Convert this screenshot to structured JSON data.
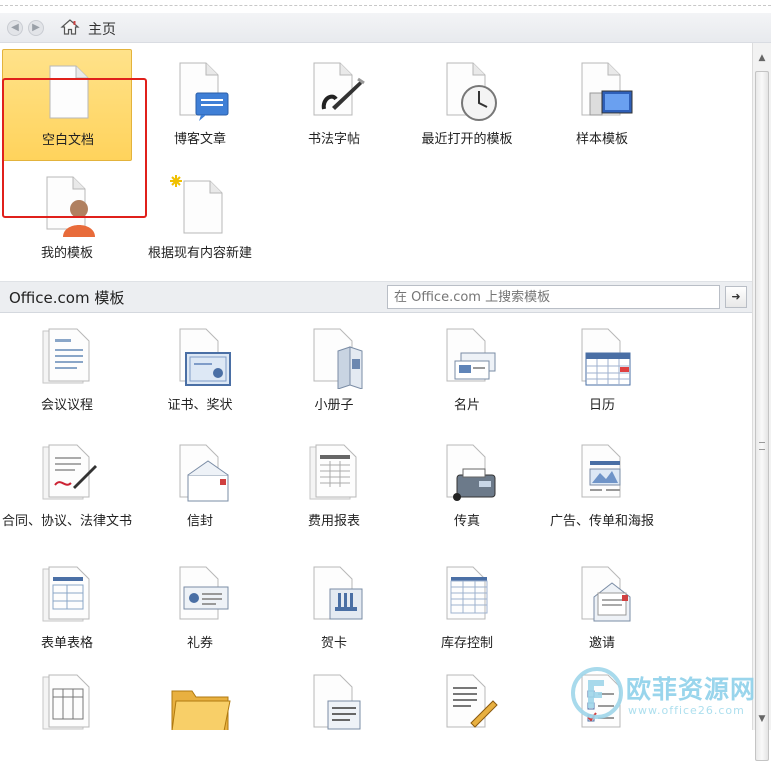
{
  "nav": {
    "breadcrumb": "主页"
  },
  "tiles_top": [
    {
      "label": "空白文档",
      "icon": "blank-document-icon"
    },
    {
      "label": "博客文章",
      "icon": "blog-post-icon"
    },
    {
      "label": "书法字帖",
      "icon": "calligraphy-icon"
    },
    {
      "label": "最近打开的模板",
      "icon": "recent-templates-icon"
    },
    {
      "label": "样本模板",
      "icon": "sample-templates-icon"
    },
    {
      "label": "我的模板",
      "icon": "my-templates-icon"
    },
    {
      "label": "根据现有内容新建",
      "icon": "new-from-existing-icon"
    }
  ],
  "office_section": {
    "title": "Office.com 模板",
    "search_placeholder": "在 Office.com 上搜索模板"
  },
  "tiles_office": [
    {
      "label": "会议议程",
      "icon": "agenda-icon"
    },
    {
      "label": "证书、奖状",
      "icon": "certificate-icon"
    },
    {
      "label": "小册子",
      "icon": "brochure-icon"
    },
    {
      "label": "名片",
      "icon": "business-card-icon"
    },
    {
      "label": "日历",
      "icon": "calendar-icon"
    },
    {
      "label": "合同、协议、法律文书",
      "icon": "contract-icon"
    },
    {
      "label": "信封",
      "icon": "envelope-icon"
    },
    {
      "label": "费用报表",
      "icon": "expense-report-icon"
    },
    {
      "label": "传真",
      "icon": "fax-icon"
    },
    {
      "label": "广告、传单和海报",
      "icon": "flyer-icon"
    },
    {
      "label": "表单表格",
      "icon": "form-icon"
    },
    {
      "label": "礼券",
      "icon": "gift-certificate-icon"
    },
    {
      "label": "贺卡",
      "icon": "greeting-card-icon"
    },
    {
      "label": "库存控制",
      "icon": "inventory-icon"
    },
    {
      "label": "邀请",
      "icon": "invitation-icon"
    }
  ],
  "tiles_partial_icons": [
    "table-doc-icon",
    "folder-icon",
    "letter-doc-icon",
    "memo-pen-icon",
    "checklist-icon"
  ],
  "watermark": {
    "text": "欧菲资源网",
    "url": "www.office26.com"
  }
}
